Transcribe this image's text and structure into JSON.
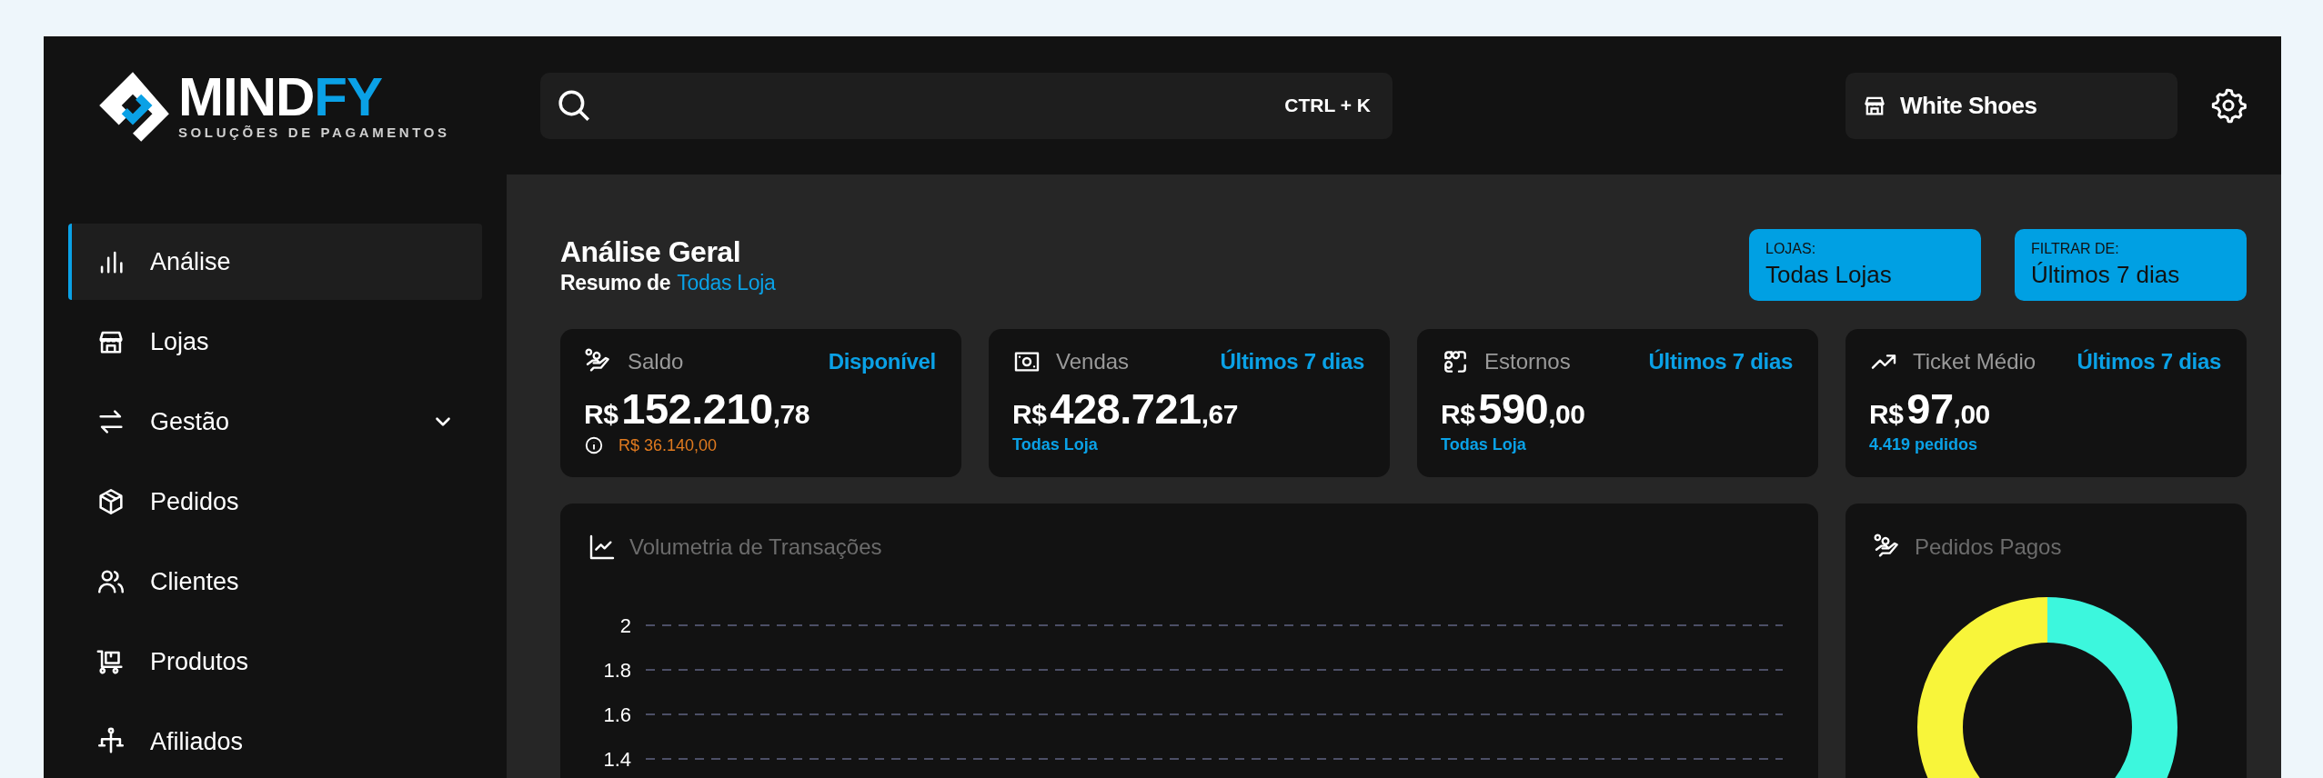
{
  "logo": {
    "wordmark_main": "MIND",
    "wordmark_accent": "FY",
    "tagline": "SOLUÇÕES DE PAGAMENTOS"
  },
  "sidebar": {
    "items": [
      {
        "label": "Análise",
        "kind": "link",
        "selected": true
      },
      {
        "label": "Lojas",
        "kind": "link",
        "selected": false
      },
      {
        "label": "Gestão",
        "kind": "group",
        "expanded": false,
        "selected": false
      },
      {
        "label": "Pedidos",
        "kind": "link",
        "selected": false
      },
      {
        "label": "Clientes",
        "kind": "link",
        "selected": false
      },
      {
        "label": "Produtos",
        "kind": "link",
        "selected": false
      },
      {
        "label": "Afiliados",
        "kind": "link",
        "selected": false
      }
    ]
  },
  "topbar": {
    "search": {
      "shortcut": "CTRL + K"
    },
    "store_selector": {
      "label": "White Shoes"
    }
  },
  "header": {
    "title": "Análise Geral",
    "subtitle_prefix": "Resumo de",
    "subtitle_highlight": "Todas Loja"
  },
  "filters": [
    {
      "label": "LOJAS:",
      "value": "Todas Lojas"
    },
    {
      "label": "FILTRAR DE:",
      "value": "Últimos 7 dias"
    }
  ],
  "stats": [
    {
      "title": "Saldo",
      "period": "Disponível",
      "currency": "R$",
      "amount": "152.210",
      "cents": ",78",
      "note": "R$ 36.140,00",
      "pending": true
    },
    {
      "title": "Vendas",
      "period": "Últimos 7 dias",
      "currency": "R$",
      "amount": "428.721",
      "cents": ",67",
      "note": "Todas Loja",
      "pending": false
    },
    {
      "title": "Estornos",
      "period": "Últimos 7 dias",
      "currency": "R$",
      "amount": "590",
      "cents": ",00",
      "note": "Todas Loja",
      "pending": false
    },
    {
      "title": "Ticket Médio",
      "period": "Últimos 7 dias",
      "currency": "R$",
      "amount": "97",
      "cents": ",00",
      "note": "4.419 pedidos",
      "pending": false
    }
  ],
  "volume_chart": {
    "title": "Volumetria de Transações",
    "y_axis_labels": [
      "2",
      "1.8",
      "1.6",
      "1.4"
    ]
  },
  "paid_orders": {
    "title": "Pedidos Pagos"
  }
}
